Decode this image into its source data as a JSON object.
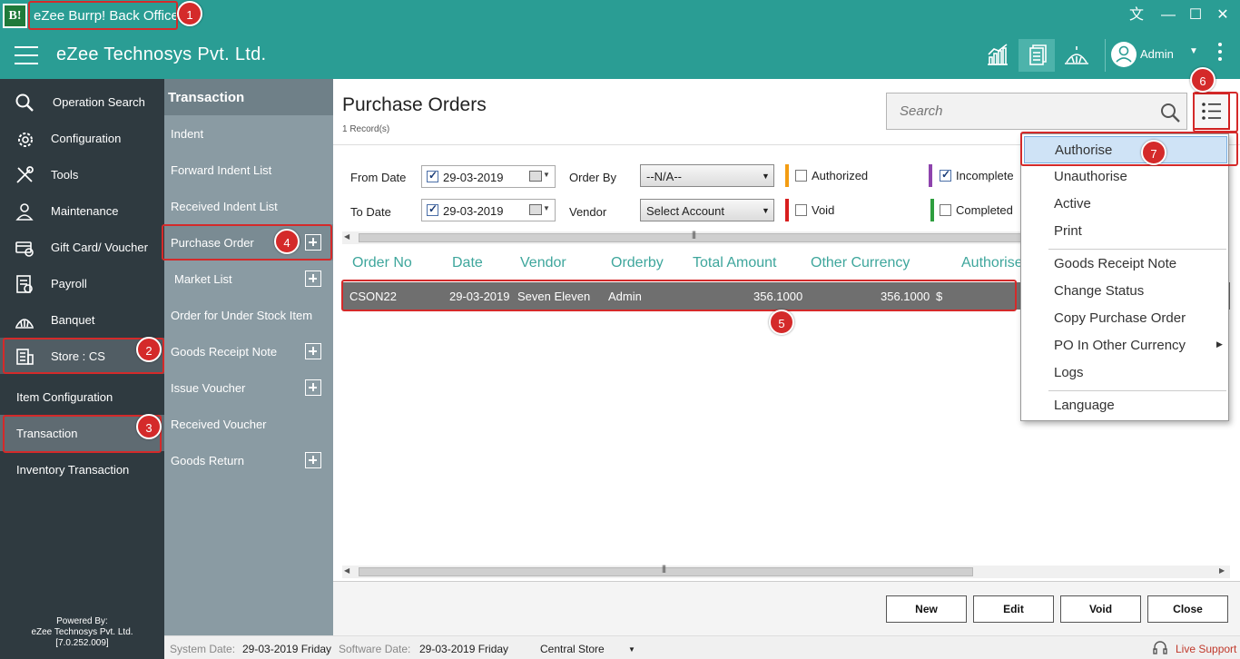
{
  "window": {
    "logo_text": "B!",
    "title": "eZee Burrp! Back Office",
    "controls": {
      "translate": "文",
      "minimize": "—",
      "maximize": "☐",
      "close": "✕"
    }
  },
  "header": {
    "company": "eZee Technosys Pvt. Ltd.",
    "user": "Admin"
  },
  "leftnav": {
    "items": [
      {
        "label": "Operation Search",
        "icon": "search-icon"
      },
      {
        "label": "Configuration",
        "icon": "gear-icon"
      },
      {
        "label": "Tools",
        "icon": "tools-icon"
      },
      {
        "label": "Maintenance",
        "icon": "maintenance-icon"
      },
      {
        "label": "Gift Card/ Voucher",
        "icon": "gift-card-icon"
      },
      {
        "label": "Payroll",
        "icon": "payroll-icon"
      },
      {
        "label": "Banquet",
        "icon": "banquet-icon"
      },
      {
        "label": "Store : CS",
        "icon": "store-icon"
      }
    ],
    "sub_items": [
      "Item Configuration",
      "Transaction",
      "Inventory Transaction"
    ],
    "powered_by": [
      "Powered By:",
      "eZee Technosys Pvt. Ltd.",
      "[7.0.252.009]"
    ]
  },
  "subnav": {
    "title": "Transaction",
    "items": [
      "Indent",
      "Forward Indent List",
      "Received Indent List",
      "Purchase Order",
      "Market List",
      "Order for Under Stock Item",
      "Goods Receipt Note",
      "Issue Voucher",
      "Received Voucher",
      "Goods Return"
    ]
  },
  "main": {
    "title": "Purchase Orders",
    "record_count": "1 Record(s)",
    "search_placeholder": "Search",
    "filters": {
      "from_date_label": "From Date",
      "from_date": "29-03-2019",
      "to_date_label": "To Date",
      "to_date": "29-03-2019",
      "order_by_label": "Order By",
      "order_by_value": "--N/A--",
      "vendor_label": "Vendor",
      "vendor_value": "Select Account",
      "statuses": [
        {
          "label": "Authorized",
          "color": "#f39c12",
          "checked": false
        },
        {
          "label": "Void",
          "color": "#d81e1e",
          "checked": false
        },
        {
          "label": "Incomplete",
          "color": "#8e44ad",
          "checked": true
        },
        {
          "label": "Completed",
          "color": "#2e9e3e",
          "checked": false
        }
      ]
    },
    "columns": [
      "Order No",
      "Date",
      "Vendor",
      "Orderby",
      "Total Amount",
      "Other Currency",
      "Authorise"
    ],
    "rows": [
      {
        "order_no": "CSON22",
        "date": "29-03-2019",
        "vendor": "Seven Eleven",
        "orderby": "Admin",
        "total": "356.1000",
        "other": "356.1000",
        "currency": "$"
      }
    ],
    "buttons": {
      "new": "New",
      "edit": "Edit",
      "void": "Void",
      "close": "Close"
    }
  },
  "statusbar": {
    "system_date_label": "System Date:",
    "system_date": "29-03-2019 Friday",
    "software_date_label": "Software Date:",
    "software_date": "29-03-2019 Friday",
    "store": "Central Store",
    "live_support": "Live Support"
  },
  "context_menu": {
    "items": [
      "Authorise",
      "Unauthorise",
      "Active",
      "Print",
      "Goods Receipt Note",
      "Change Status",
      "Copy Purchase Order",
      "PO In Other Currency",
      "Logs",
      "Language"
    ]
  },
  "markers": [
    "1",
    "2",
    "3",
    "4",
    "5",
    "6",
    "7"
  ]
}
